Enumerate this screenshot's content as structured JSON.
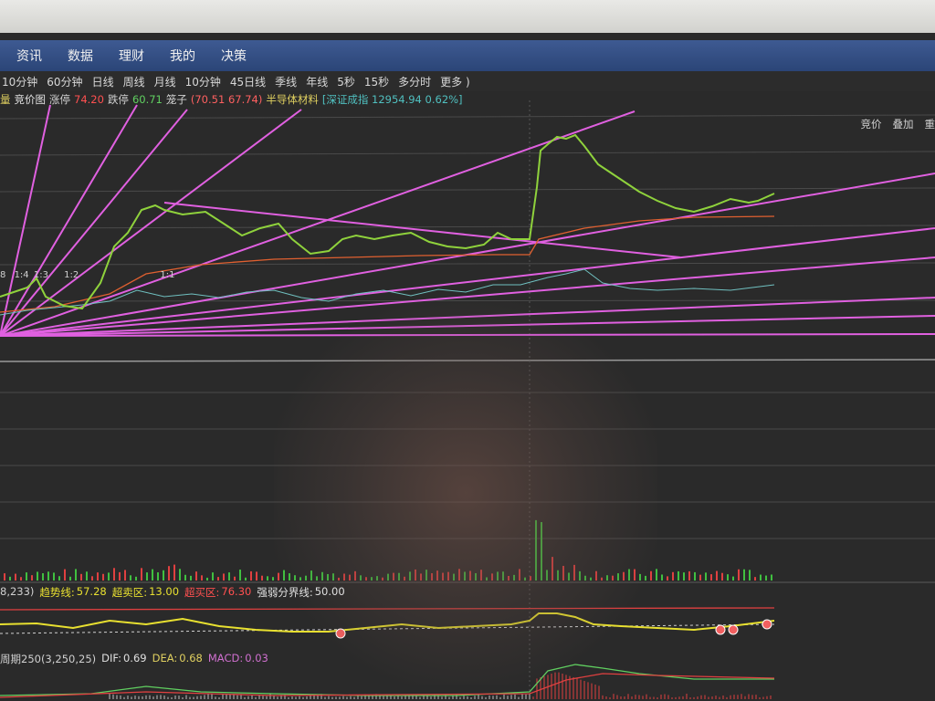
{
  "menu": [
    "资讯",
    "数据",
    "理财",
    "我的",
    "决策"
  ],
  "periods": [
    "10分钟",
    "60分钟",
    "日线",
    "周线",
    "月线",
    "10分钟",
    "45日线",
    "季线",
    "年线",
    "5秒",
    "15秒",
    "多分时",
    "更多 )"
  ],
  "info": {
    "volume_label": "量",
    "auction_label": "竞价图",
    "limit_up_label": "涨停",
    "limit_up_value": "74.20",
    "limit_down_label": "跌停",
    "limit_down_value": "60.71",
    "cage_label": "笼子",
    "cage_value": "(70.51 67.74)",
    "sector": "半导体材料",
    "index": "[深证成指 12954.94 0.62%]"
  },
  "right_tabs": [
    "竞价",
    "叠加",
    "重"
  ],
  "fib_labels": [
    "8",
    "1:4",
    "1:3",
    "1:2",
    "1:1"
  ],
  "indicator1": {
    "params": "8,233)",
    "trend_label": "趋势线:",
    "trend_value": "57.28",
    "oversold_label": "超卖区:",
    "oversold_value": "13.00",
    "overbought_label": "超买区:",
    "overbought_value": "76.30",
    "divider_label": "强弱分界线:",
    "divider_value": "50.00"
  },
  "indicator2": {
    "name": "周期250(3,250,25)",
    "dif_label": "DIF:",
    "dif_value": "0.69",
    "dea_label": "DEA:",
    "dea_value": "0.68",
    "macd_label": "MACD:",
    "macd_value": "0.03"
  },
  "colors": {
    "price_line": "#8fd23c",
    "avg_line": "#e06030",
    "fan_lines": "#e060e0",
    "up_bar": "#e04040",
    "down_bar": "#40c040",
    "trend_line": "#e8e030",
    "menubar": "#34508a"
  }
}
